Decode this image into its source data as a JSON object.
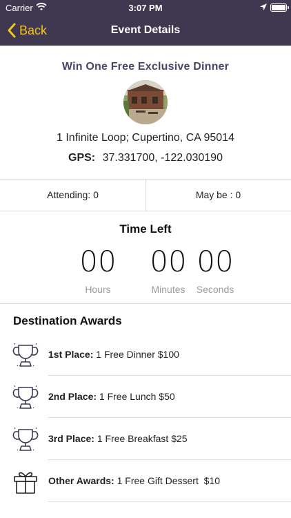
{
  "status_bar": {
    "carrier": "Carrier",
    "time": "3:07 PM"
  },
  "nav": {
    "back_label": "Back",
    "title": "Event Details"
  },
  "event": {
    "title": "Win One Free Exclusive Dinner",
    "address": "1 Infinite Loop; Cupertino, CA 95014",
    "gps_label": "GPS:",
    "gps_value": "37.331700, -122.030190"
  },
  "attendance": {
    "attending": "Attending: 0",
    "maybe": "May be : 0"
  },
  "countdown": {
    "title": "Time Left",
    "hours": "00",
    "minutes": "00",
    "seconds": "00",
    "hours_label": "Hours",
    "minutes_label": "Minutes",
    "seconds_label": "Seconds"
  },
  "awards": {
    "title": "Destination Awards",
    "items": [
      {
        "place": "1st Place:",
        "prize": "1 Free Dinner $100",
        "icon": "trophy-icon"
      },
      {
        "place": "2nd Place:",
        "prize": "1 Free Lunch $50",
        "icon": "trophy-icon"
      },
      {
        "place": "3rd Place:",
        "prize": "1 Free Breakfast $25",
        "icon": "trophy-icon"
      },
      {
        "place": "Other Awards:",
        "prize": "1 Free Gift Dessert  $10",
        "icon": "gift-icon"
      }
    ]
  },
  "colors": {
    "header_bg": "#3f3850",
    "accent": "#f5c518",
    "title_purple": "#4a4466"
  }
}
